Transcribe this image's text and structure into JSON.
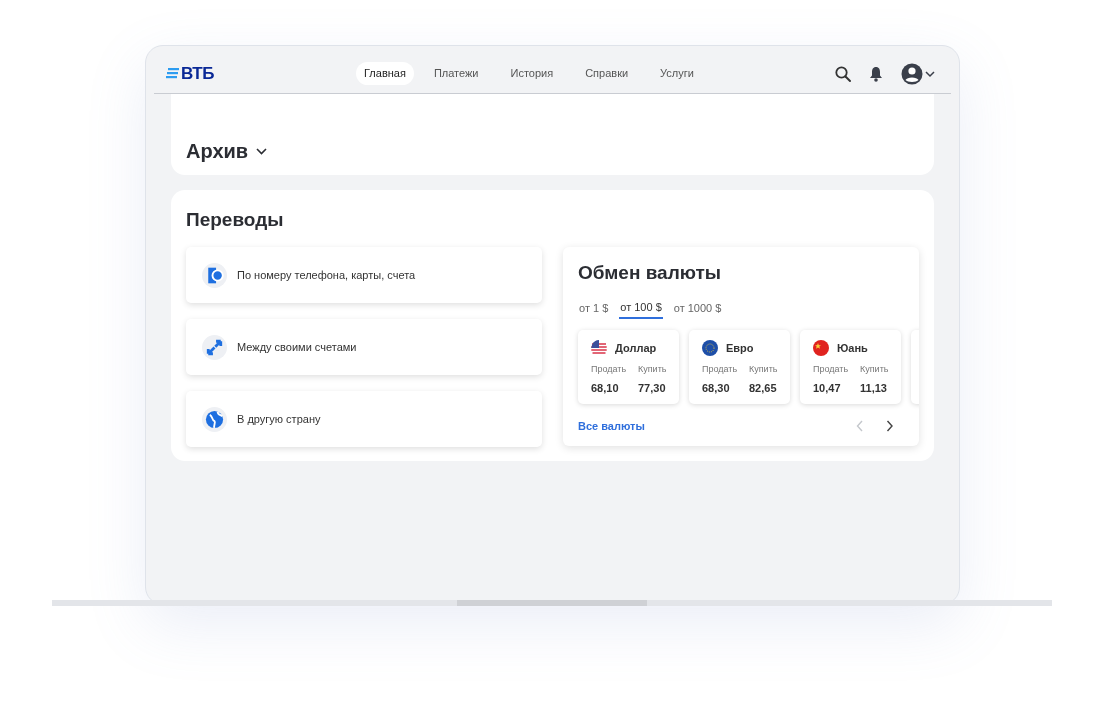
{
  "header": {
    "logo": "ВТБ",
    "nav": [
      {
        "label": "Главная",
        "selected": true
      },
      {
        "label": "Платежи",
        "selected": false
      },
      {
        "label": "История",
        "selected": false
      },
      {
        "label": "Справки",
        "selected": false
      },
      {
        "label": "Услуги",
        "selected": false
      }
    ]
  },
  "top_card": {
    "archive": "Архив",
    "archive_expanded": false
  },
  "transfers": {
    "title": "Переводы",
    "items": [
      {
        "kind": "phone",
        "label": "По номеру телефона, карты, счета"
      },
      {
        "kind": "own",
        "label": "Между своими счетами"
      },
      {
        "kind": "abroad",
        "label": "В другую страну"
      }
    ]
  },
  "exchange": {
    "title": "Обмен валюты",
    "tabs": [
      {
        "label": "от 1 $",
        "selected": false
      },
      {
        "label": "от 100 $",
        "selected": true
      },
      {
        "label": "от 1000 $",
        "selected": false
      }
    ],
    "currencies": [
      {
        "kind": "usd",
        "name": "Доллар",
        "sell_label": "Продать",
        "buy_label": "Купить",
        "sell": "68,10",
        "buy": "77,30"
      },
      {
        "kind": "eur",
        "name": "Евро",
        "sell_label": "Продать",
        "buy_label": "Купить",
        "sell": "68,30",
        "buy": "82,65"
      },
      {
        "kind": "cny",
        "name": "Юань",
        "sell_label": "Продать",
        "buy_label": "Купить",
        "sell": "10,47",
        "buy": "11,13"
      }
    ],
    "all_link": "Все валюты",
    "prev_disabled": true,
    "next_disabled": false
  }
}
